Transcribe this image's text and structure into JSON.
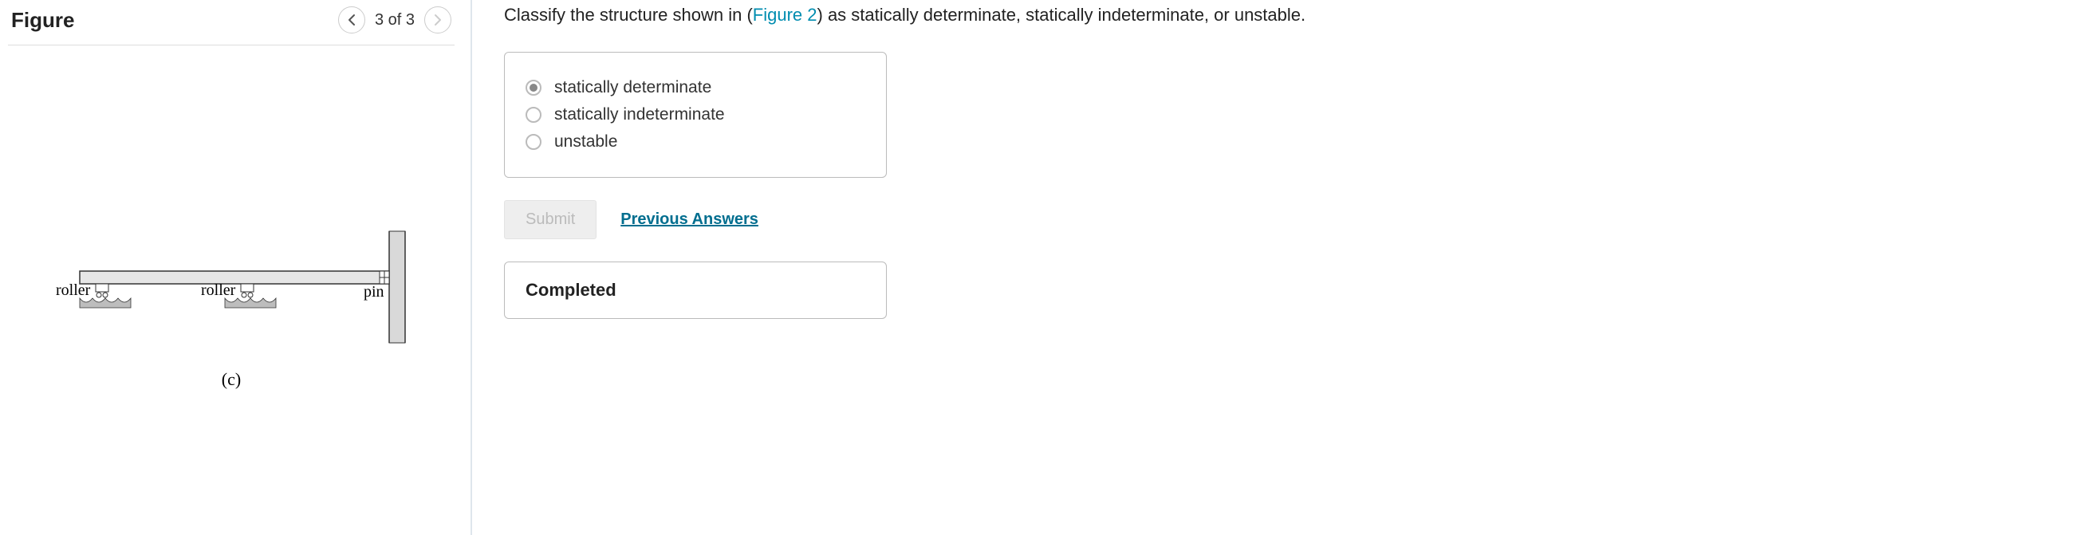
{
  "figure": {
    "title": "Figure",
    "pager": "3 of 3",
    "labels": {
      "rollerA": "roller",
      "rollerB": "roller",
      "pin": "pin"
    },
    "caption": "(c)"
  },
  "question": {
    "prefix": "Classify the structure shown in (",
    "link": "Figure 2",
    "suffix": ") as statically determinate, statically indeterminate, or unstable."
  },
  "options": {
    "a": "statically determinate",
    "b": "statically indeterminate",
    "c": "unstable"
  },
  "actions": {
    "submit": "Submit",
    "prev": "Previous Answers"
  },
  "status": "Completed"
}
